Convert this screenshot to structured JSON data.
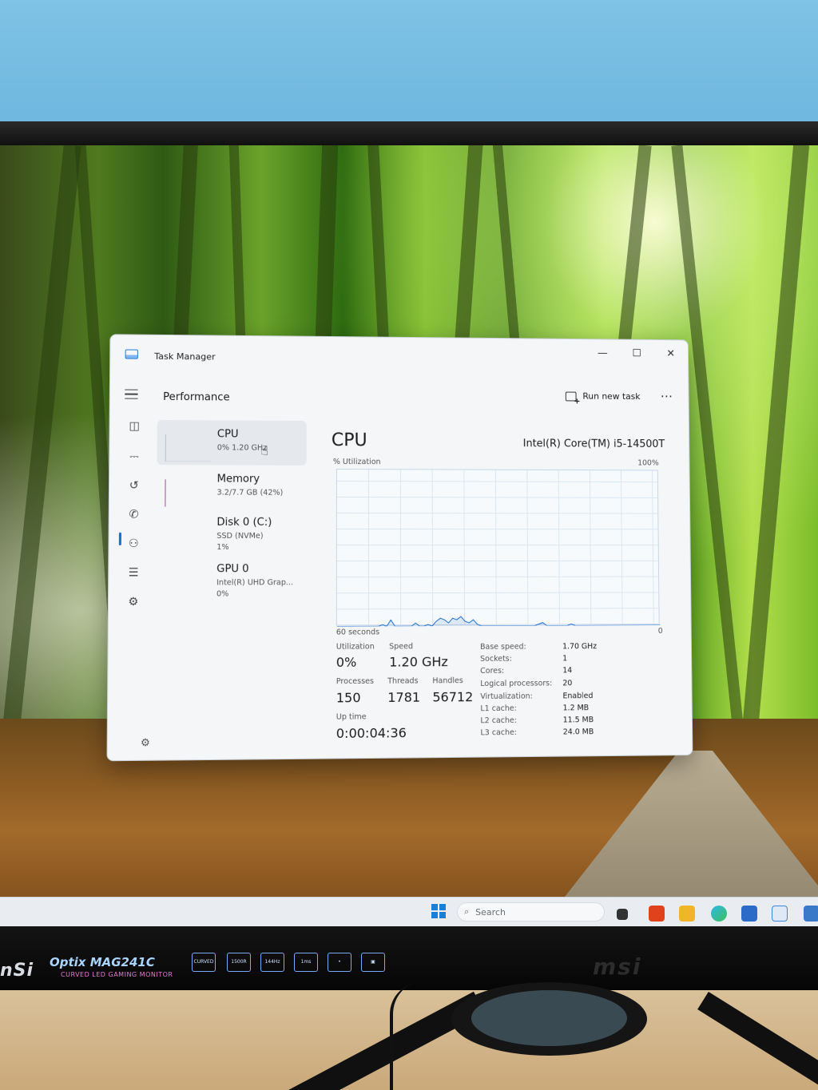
{
  "window": {
    "app_name": "Task Manager",
    "section_title": "Performance",
    "run_new_task_label": "Run new task",
    "more_label": "⋯",
    "minimize_label": "—",
    "maximize_label": "☐",
    "close_label": "✕"
  },
  "nav": [
    {
      "icon": "hamburger-icon"
    },
    {
      "icon": "processes-icon",
      "glyph": "◫"
    },
    {
      "icon": "performance-icon",
      "glyph": "⎓",
      "active": true
    },
    {
      "icon": "app-history-icon",
      "glyph": "↺"
    },
    {
      "icon": "startup-apps-icon",
      "glyph": "✆"
    },
    {
      "icon": "users-icon",
      "glyph": "⚇"
    },
    {
      "icon": "details-icon",
      "glyph": "☰"
    },
    {
      "icon": "services-icon",
      "glyph": "⚙"
    }
  ],
  "perf_list": [
    {
      "name": "CPU",
      "sub1": "0%  1.20 GHz",
      "sub2": "",
      "selected": true
    },
    {
      "name": "Memory",
      "sub1": "3.2/7.7 GB (42%)",
      "sub2": ""
    },
    {
      "name": "Disk 0 (C:)",
      "sub1": "SSD (NVMe)",
      "sub2": "1%"
    },
    {
      "name": "GPU 0",
      "sub1": "Intel(R) UHD Grap...",
      "sub2": "0%"
    }
  ],
  "cpu": {
    "title": "CPU",
    "model": "Intel(R) Core(TM) i5-14500T",
    "util_label": "% Utilization",
    "util_max": "100%",
    "graph_left": "60 seconds",
    "graph_right": "0",
    "utilization_label": "Utilization",
    "utilization": "0%",
    "speed_label": "Speed",
    "speed": "1.20 GHz",
    "processes_label": "Processes",
    "processes": "150",
    "threads_label": "Threads",
    "threads": "1781",
    "handles_label": "Handles",
    "handles": "56712",
    "uptime_label": "Up time",
    "uptime": "0:00:04:36",
    "specs": [
      {
        "label": "Base speed:",
        "value": "1.70 GHz"
      },
      {
        "label": "Sockets:",
        "value": "1"
      },
      {
        "label": "Cores:",
        "value": "14"
      },
      {
        "label": "Logical processors:",
        "value": "20"
      },
      {
        "label": "Virtualization:",
        "value": "Enabled"
      },
      {
        "label": "L1 cache:",
        "value": "1.2 MB"
      },
      {
        "label": "L2 cache:",
        "value": "11.5 MB"
      },
      {
        "label": "L3 cache:",
        "value": "24.0 MB"
      }
    ],
    "graph_samples": [
      0,
      0,
      0,
      0,
      0,
      0,
      0,
      0,
      0,
      0,
      0,
      1,
      0,
      4,
      0,
      0,
      0,
      0,
      0,
      2,
      0,
      0,
      1,
      0,
      3,
      5,
      4,
      2,
      5,
      4,
      6,
      3,
      2,
      4,
      1,
      0,
      0,
      0,
      0,
      0,
      0,
      0,
      0,
      0,
      0,
      0,
      0,
      0,
      0,
      1,
      2,
      0,
      0,
      0,
      0,
      0,
      0,
      1,
      0,
      0,
      0,
      0,
      0,
      0,
      0,
      0,
      0,
      0,
      0,
      0,
      0,
      0,
      0,
      0,
      0,
      0,
      0,
      0,
      0,
      0
    ]
  },
  "taskbar": {
    "search_placeholder": "Search"
  },
  "bezel": {
    "brand_left": "nSi",
    "model": "Optix MAG241C",
    "model_sub": "CURVED LED GAMING MONITOR",
    "brand_right": "msi",
    "features": [
      "CURVED",
      "1500R",
      "144Hz",
      "1ms",
      "•",
      "▣"
    ]
  },
  "colors": {
    "accent": "#1f6fd1",
    "cpu_graph": "#1f6fd1",
    "memory_graph": "#a14ea6"
  }
}
